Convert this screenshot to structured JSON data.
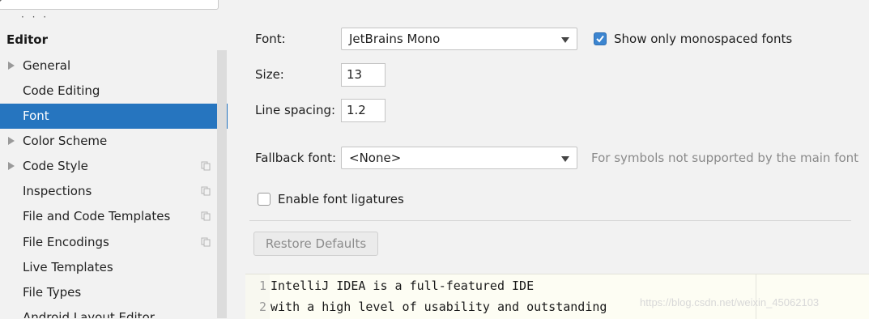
{
  "sidebar": {
    "section_title": "Editor",
    "items": [
      {
        "label": "General",
        "expandable": true,
        "selected": false,
        "has_copy_icon": false
      },
      {
        "label": "Code Editing",
        "expandable": false,
        "selected": false,
        "has_copy_icon": false
      },
      {
        "label": "Font",
        "expandable": false,
        "selected": true,
        "has_copy_icon": false
      },
      {
        "label": "Color Scheme",
        "expandable": true,
        "selected": false,
        "has_copy_icon": false
      },
      {
        "label": "Code Style",
        "expandable": true,
        "selected": false,
        "has_copy_icon": true
      },
      {
        "label": "Inspections",
        "expandable": false,
        "selected": false,
        "has_copy_icon": true
      },
      {
        "label": "File and Code Templates",
        "expandable": false,
        "selected": false,
        "has_copy_icon": true
      },
      {
        "label": "File Encodings",
        "expandable": false,
        "selected": false,
        "has_copy_icon": true
      },
      {
        "label": "Live Templates",
        "expandable": false,
        "selected": false,
        "has_copy_icon": false
      },
      {
        "label": "File Types",
        "expandable": false,
        "selected": false,
        "has_copy_icon": false
      },
      {
        "label": "Android Layout Editor",
        "expandable": false,
        "selected": false,
        "has_copy_icon": false
      }
    ]
  },
  "font": {
    "font_label": "Font:",
    "font_value": "JetBrains Mono",
    "monospaced_label": "Show only monospaced fonts",
    "monospaced_checked": true,
    "size_label": "Size:",
    "size_value": "13",
    "line_spacing_label": "Line spacing:",
    "line_spacing_value": "1.2",
    "fallback_label": "Fallback font:",
    "fallback_value": "<None>",
    "fallback_hint": "For symbols not supported by the main font",
    "ligatures_label": "Enable font ligatures",
    "ligatures_checked": false,
    "restore_button": "Restore Defaults"
  },
  "preview": {
    "lines": [
      {
        "number": "1",
        "text": "IntelliJ IDEA is a full-featured IDE"
      },
      {
        "number": "2",
        "text": "with a high level of usability and outstanding"
      }
    ]
  },
  "watermark": "https://blog.csdn.net/weixin_45062103",
  "colors": {
    "selection": "#2675bf",
    "checkbox_checked": "#3c85d0",
    "background": "#f2f2f2"
  }
}
